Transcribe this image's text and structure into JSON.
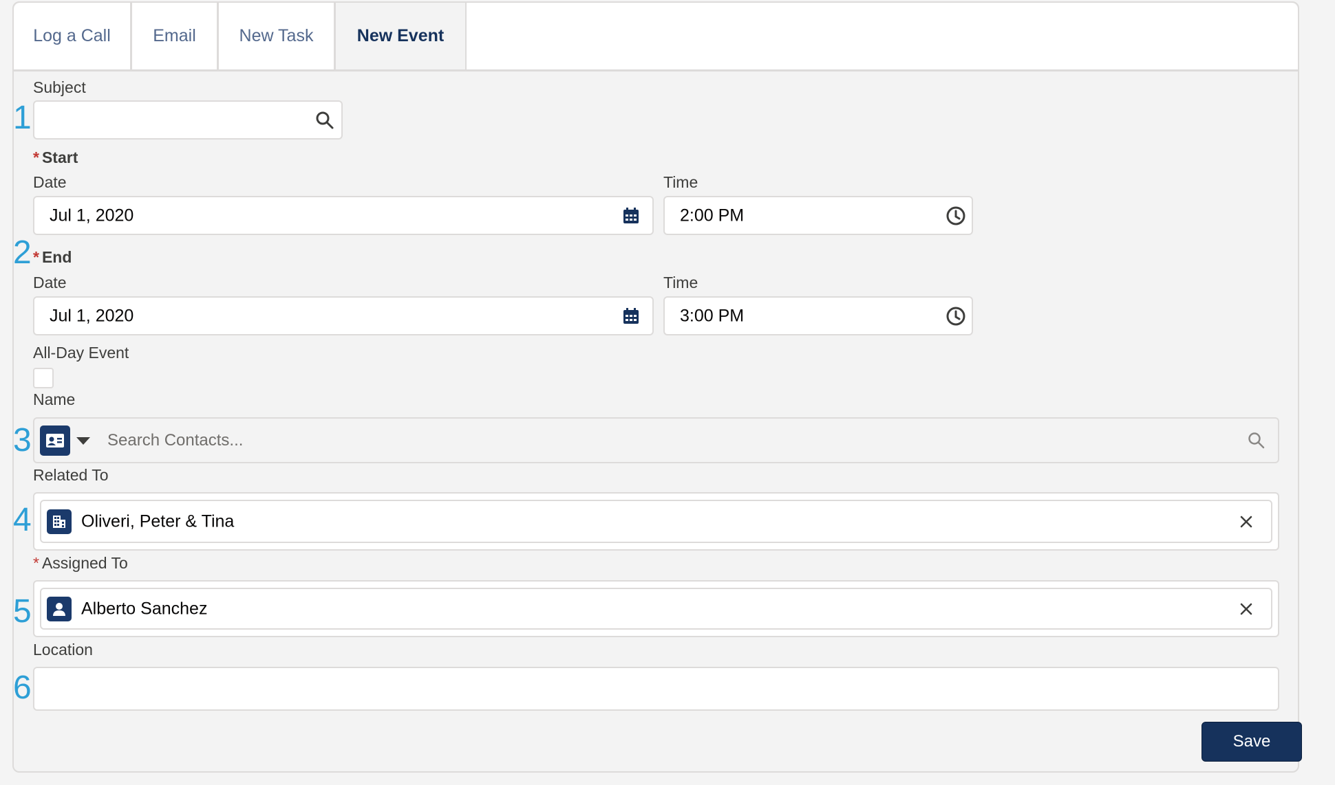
{
  "tabs": [
    {
      "label": "Log a Call"
    },
    {
      "label": "Email"
    },
    {
      "label": "New Task"
    },
    {
      "label": "New Event"
    }
  ],
  "markers": [
    "1",
    "2",
    "3",
    "4",
    "5",
    "6"
  ],
  "form": {
    "subject_label": "Subject",
    "subject_value": "",
    "start_label": "Start",
    "end_label": "End",
    "date_label": "Date",
    "time_label": "Time",
    "start_date": "Jul 1, 2020",
    "start_time": "2:00 PM",
    "end_date": "Jul 1, 2020",
    "end_time": "3:00 PM",
    "all_day_label": "All-Day Event",
    "all_day_checked": false,
    "name_label": "Name",
    "name_placeholder": "Search Contacts...",
    "related_label": "Related To",
    "related_value": "Oliveri, Peter & Tina",
    "assigned_label": "Assigned To",
    "assigned_value": "Alberto Sanchez",
    "location_label": "Location",
    "location_value": "",
    "required_mark": "*"
  },
  "save_label": "Save",
  "colors": {
    "brand": "#16325c",
    "required": "#c23934",
    "marker": "#2e9fd6",
    "tab_text": "#54698d"
  },
  "icons": {
    "subject": "search-icon",
    "date": "calendar-icon",
    "time": "clock-icon",
    "name_type": "contact-card-icon",
    "name_search": "search-icon",
    "related": "account-building-icon",
    "assigned": "user-icon",
    "clear": "close-icon"
  }
}
